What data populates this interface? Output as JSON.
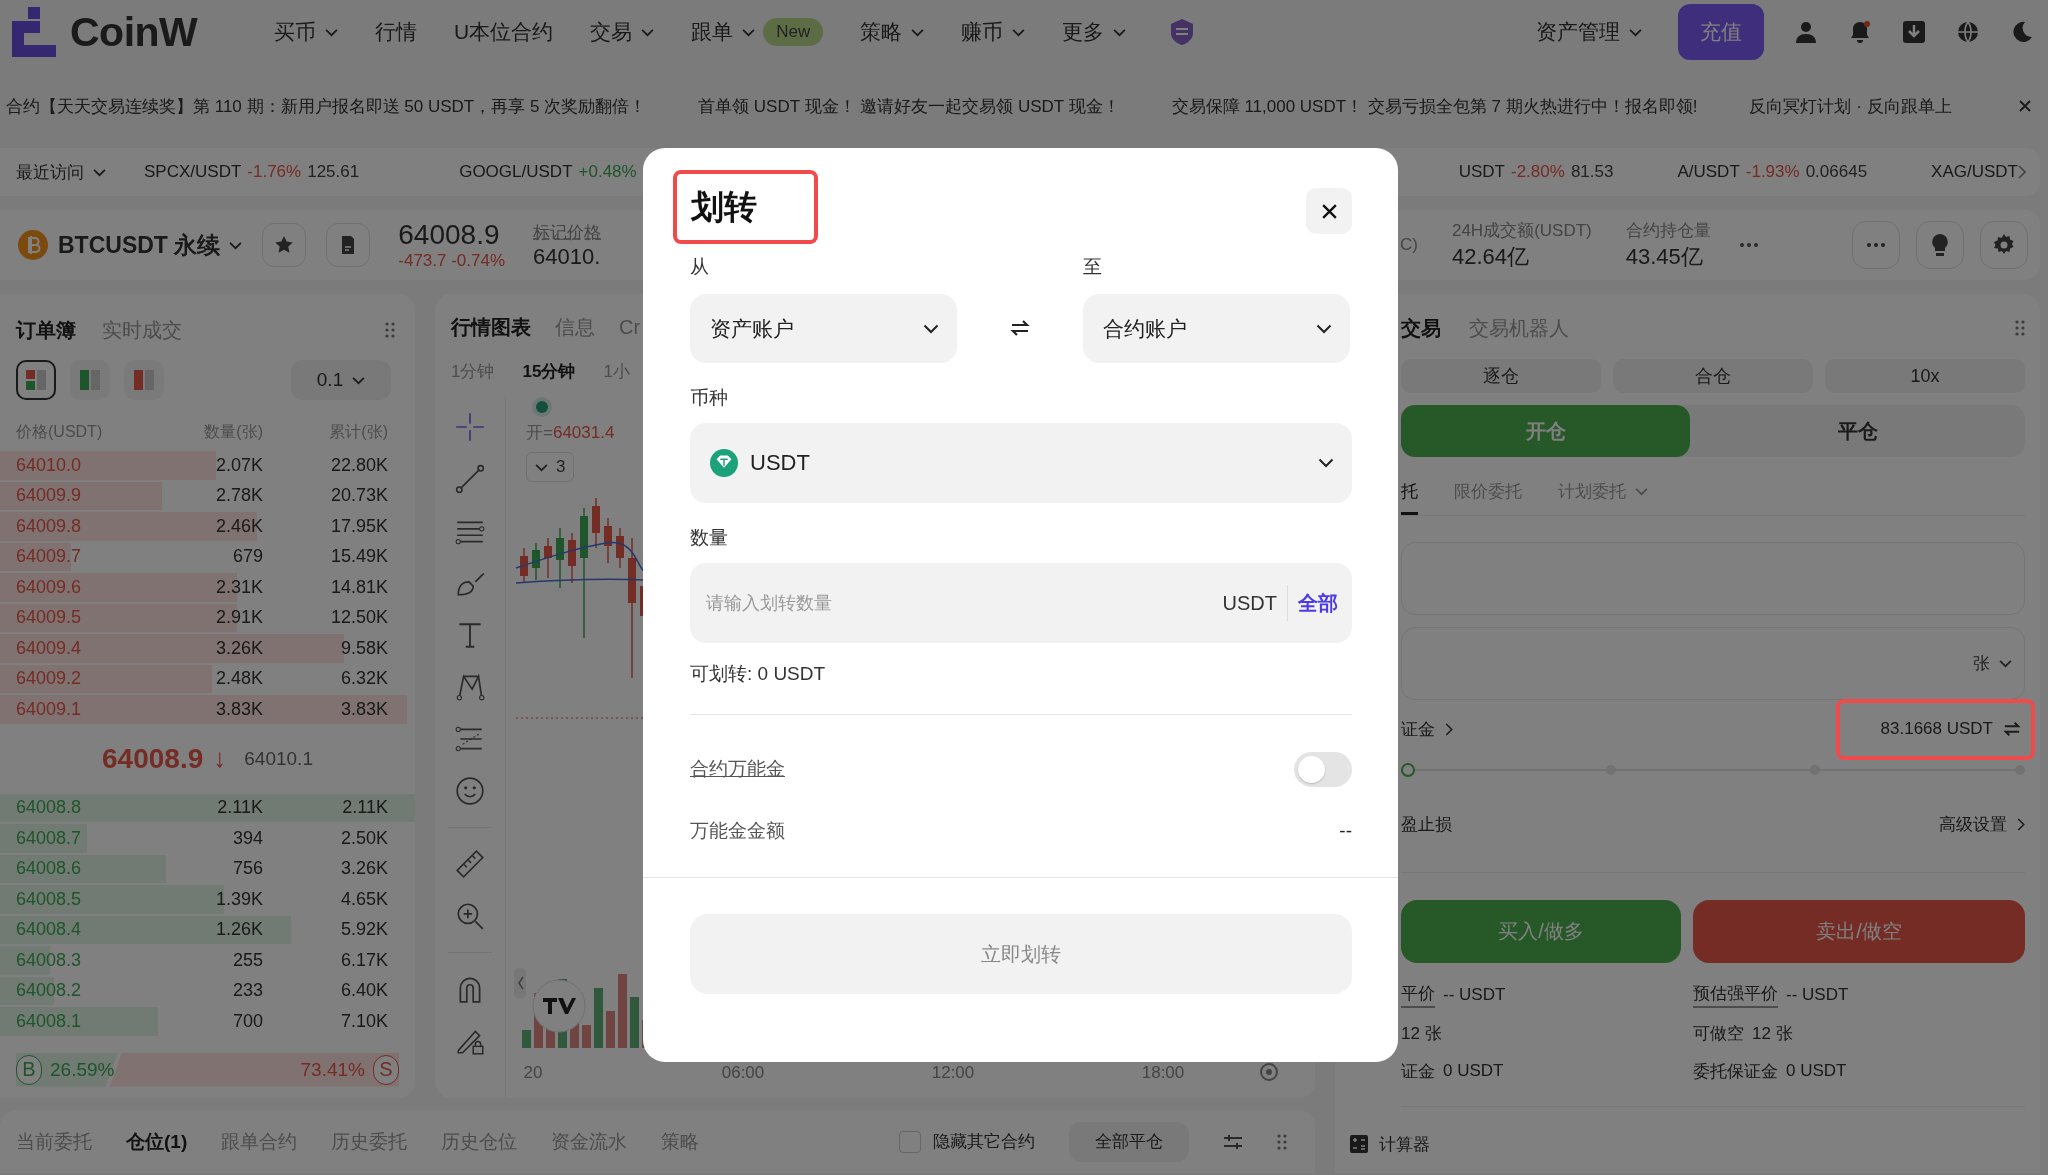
{
  "nav": {
    "logo": "CoinW",
    "items": [
      {
        "label": "买币",
        "dropdown": true
      },
      {
        "label": "行情",
        "dropdown": false
      },
      {
        "label": "U本位合约",
        "dropdown": false
      },
      {
        "label": "交易",
        "dropdown": true
      },
      {
        "label": "跟单",
        "dropdown": true,
        "badge": "New"
      },
      {
        "label": "策略",
        "dropdown": true
      },
      {
        "label": "赚币",
        "dropdown": true
      },
      {
        "label": "更多",
        "dropdown": true
      }
    ],
    "asset_menu": "资产管理",
    "deposit_button": "充值",
    "notification_dot": true
  },
  "announcements": [
    "合约【天天交易连续奖】第 110 期：新用户报名即送 50 USDT，再享 5 次奖励翻倍！",
    "首单领 USDT 现金！ 邀请好友一起交易领 USDT 现金！",
    "交易保障 11,000 USDT！ 交易亏损全包第 7 期火热进行中！报名即领!",
    "反向冥灯计划 · 反向跟单上"
  ],
  "ticker": {
    "recent": "最近访问",
    "items": [
      {
        "pair": "SPCX/USDT",
        "change": "-1.76%",
        "price": "125.61",
        "rising": false
      },
      {
        "pair": "GOOGL/USDT",
        "change": "+0.48%",
        "rising": true
      },
      {
        "pair": "USDT",
        "change": "-2.80%",
        "price": "81.53",
        "rising": false
      },
      {
        "pair": "A/USDT",
        "change": "-1.93%",
        "price": "0.06645",
        "rising": false
      },
      {
        "pair": "XAG/USDT"
      }
    ]
  },
  "symbol_bar": {
    "symbol": "BTCUSDT 永续",
    "last_price": "64008.9",
    "change": "-473.7 -0.74%",
    "mark_price_label": "标记价格",
    "mark_price": "64010.",
    "stats": [
      {
        "label": "C)"
      },
      {
        "label": "24H成交额(USDT)",
        "value": "42.64亿"
      },
      {
        "label": "合约持仓量",
        "value": "43.45亿"
      }
    ]
  },
  "order_book": {
    "tabs": [
      {
        "label": "订单簿",
        "selected": true
      },
      {
        "label": "实时成交",
        "selected": false
      }
    ],
    "views": [
      {
        "kind": "both",
        "selected": true
      },
      {
        "kind": "bids",
        "selected": false
      },
      {
        "kind": "asks",
        "selected": false
      }
    ],
    "precision": "0.1",
    "columns": [
      "价格(USDT)",
      "数量(张)",
      "累计(张)"
    ],
    "asks": [
      {
        "price": "64010.0",
        "amount": "2.07K",
        "total": "22.80K",
        "level": 0.52
      },
      {
        "price": "64009.9",
        "amount": "2.78K",
        "total": "20.73K",
        "level": 0.39
      },
      {
        "price": "64009.8",
        "amount": "2.46K",
        "total": "17.95K",
        "level": 0.62
      },
      {
        "price": "64009.7",
        "amount": "679",
        "total": "15.49K",
        "level": 0.17
      },
      {
        "price": "64009.6",
        "amount": "2.31K",
        "total": "14.81K",
        "level": 0.57
      },
      {
        "price": "64009.5",
        "amount": "2.91K",
        "total": "12.50K",
        "level": 0.57
      },
      {
        "price": "64009.4",
        "amount": "3.26K",
        "total": "9.58K",
        "level": 0.83
      },
      {
        "price": "64009.2",
        "amount": "2.48K",
        "total": "6.32K",
        "level": 0.51
      },
      {
        "price": "64009.1",
        "amount": "3.83K",
        "total": "3.83K",
        "level": 0.98
      }
    ],
    "last_price": "64008.9",
    "arrow": "↓",
    "mark_price": "64010.1",
    "bids": [
      {
        "price": "64008.8",
        "amount": "2.11K",
        "total": "2.11K",
        "level": 1.0
      },
      {
        "price": "64008.7",
        "amount": "394",
        "total": "2.50K",
        "level": 0.21
      },
      {
        "price": "64008.6",
        "amount": "756",
        "total": "3.26K",
        "level": 0.4
      },
      {
        "price": "64008.5",
        "amount": "1.39K",
        "total": "4.65K",
        "level": 0.54
      },
      {
        "price": "64008.4",
        "amount": "1.26K",
        "total": "5.92K",
        "level": 0.7
      },
      {
        "price": "64008.3",
        "amount": "255",
        "total": "6.17K",
        "level": 0.12
      },
      {
        "price": "64008.2",
        "amount": "233",
        "total": "6.40K",
        "level": 0.13
      },
      {
        "price": "64008.1",
        "amount": "700",
        "total": "7.10K",
        "level": 0.38
      }
    ],
    "ratio": {
      "buy_tag": "B",
      "buy": "26.59%",
      "sell": "73.41%",
      "sell_tag": "S",
      "level": 0.2659
    }
  },
  "chart": {
    "tabs": [
      {
        "label": "行情图表",
        "selected": true
      },
      {
        "label": "信息",
        "selected": false
      },
      {
        "label": "Cr",
        "selected": false
      }
    ],
    "intervals": [
      {
        "label": "1分钟",
        "selected": false
      },
      {
        "label": "15分钟",
        "selected": true
      },
      {
        "label": "1小",
        "selected": false
      }
    ],
    "legend_label": "开=",
    "legend_value": "64031.4",
    "indicator_count": "3",
    "time_labels": [
      "20",
      "06:00",
      "12:00",
      "18:00"
    ]
  },
  "trade_panel": {
    "tabs": [
      {
        "label": "交易",
        "selected": true
      },
      {
        "label": "交易机器人",
        "selected": false
      }
    ],
    "margin_modes": [
      "逐仓",
      "合仓",
      "10x"
    ],
    "sides": [
      {
        "label": "开仓",
        "selected": true
      },
      {
        "label": "平仓",
        "selected": false
      }
    ],
    "order_types": [
      {
        "label": "托",
        "selected": true,
        "dropdown": false
      },
      {
        "label": "限价委托",
        "selected": false,
        "dropdown": false
      },
      {
        "label": "计划委托",
        "selected": false,
        "dropdown": true
      }
    ],
    "quantity_unit": "张",
    "margin_label": "证金",
    "margin_value": "83.1668 USDT",
    "margin_value_highlighted": true,
    "slider": {
      "level": 0
    },
    "tp_sl": "盈止损",
    "advanced": "高级设置",
    "buy": "买入/做多",
    "sell": "卖出/做空",
    "long_info": [
      {
        "label": "平价",
        "value": "-- USDT",
        "underlined": true
      },
      {
        "value": "12 张",
        "underlined": false
      },
      {
        "label": "证金",
        "value": "0 USDT",
        "underlined": false
      }
    ],
    "short_info": [
      {
        "label": "预估强平价",
        "value": "-- USDT",
        "underlined": true
      },
      {
        "label": "可做空",
        "value": "12 张",
        "underlined": false
      },
      {
        "label": "委托保证金",
        "value": "0 USDT",
        "underlined": false
      }
    ],
    "calculator": "计算器"
  },
  "positions_bar": {
    "tabs": [
      {
        "label": "当前委托",
        "selected": false
      },
      {
        "label": "仓位(1)",
        "selected": true
      },
      {
        "label": "跟单合约",
        "selected": false
      },
      {
        "label": "历史委托",
        "selected": false
      },
      {
        "label": "历史仓位",
        "selected": false
      },
      {
        "label": "资金流水",
        "selected": false
      },
      {
        "label": "策略",
        "selected": false
      }
    ],
    "hide_others": {
      "label": "隐藏其它合约",
      "checked": false
    },
    "close_all": "全部平仓"
  },
  "dialog": {
    "title": "划转",
    "title_highlighted": true,
    "from_label": "从",
    "from": "资产账户",
    "to_label": "至",
    "to": "合约账户",
    "coin_label": "币种",
    "coin": "USDT",
    "amount_label": "数量",
    "amount_placeholder": "请输入划转数量",
    "amount_unit": "USDT",
    "max": "全部",
    "available": "可划转: 0 USDT",
    "bonus_label": "合约万能金",
    "bonus_on": false,
    "bonus_amount_label": "万能金金额",
    "bonus_amount": "--",
    "submit": "立即划转",
    "submit_disabled": true
  }
}
